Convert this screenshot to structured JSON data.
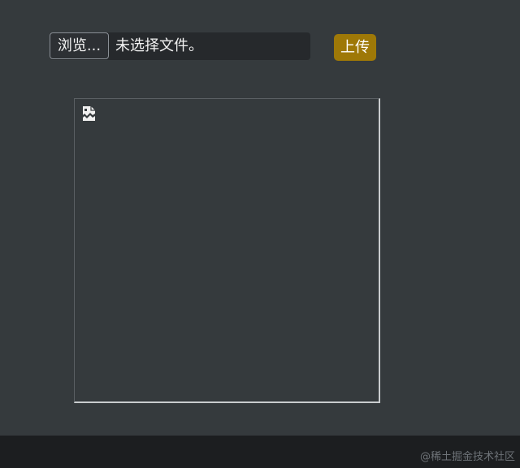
{
  "form": {
    "browse_label": "浏览...",
    "file_status": "未选择文件。",
    "upload_label": "上传"
  },
  "preview": {
    "icon": "broken-image-icon"
  },
  "footer": {
    "watermark": "@稀土掘金技术社区"
  },
  "colors": {
    "page_background": "#353a3d",
    "file_field_background": "#26292c",
    "upload_button": "#9e7807",
    "footer_background": "#1c1e20"
  }
}
